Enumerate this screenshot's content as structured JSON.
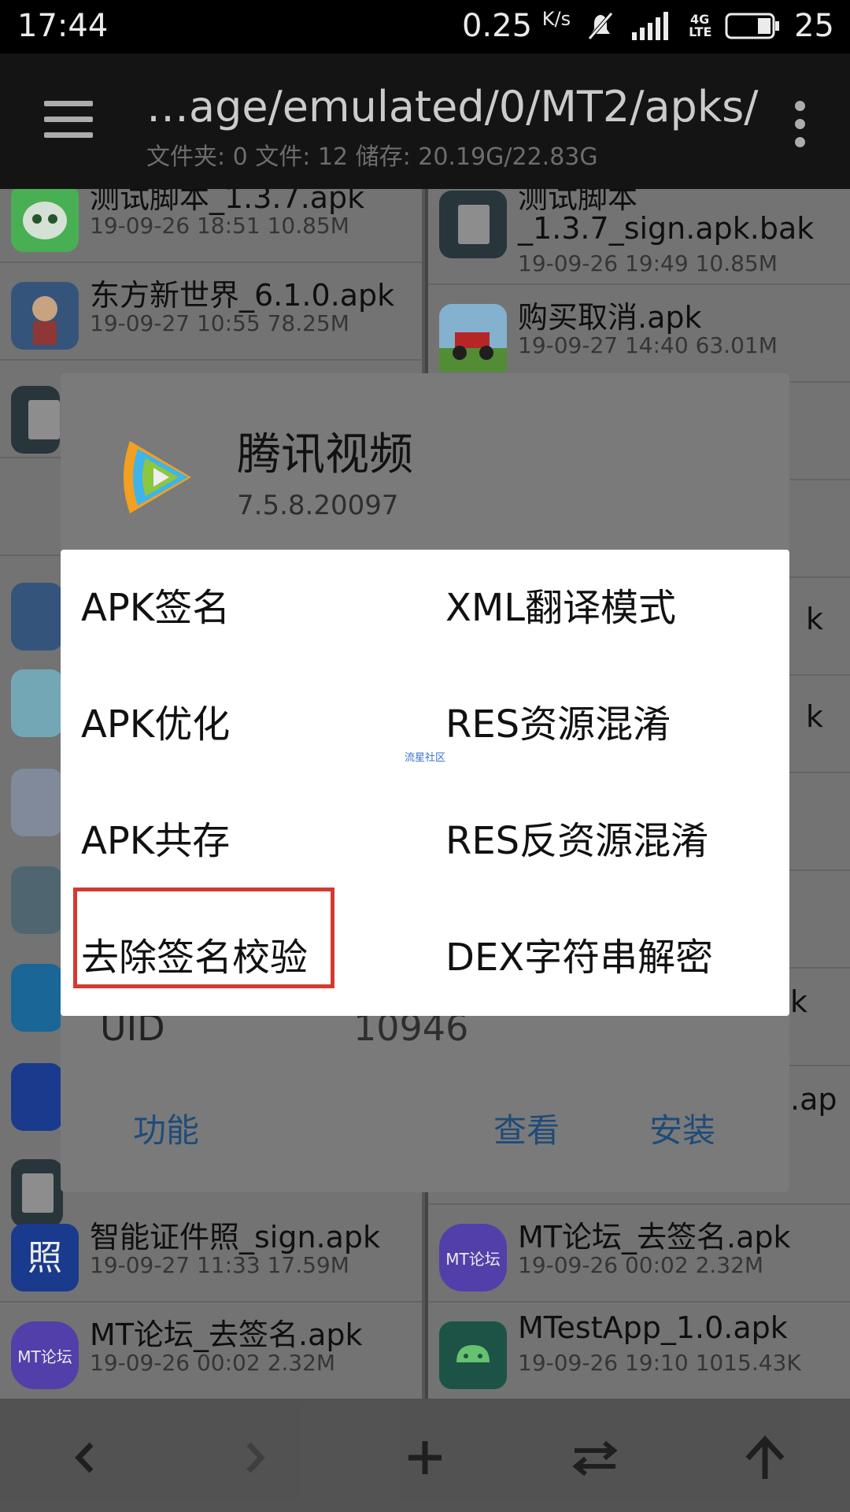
{
  "status": {
    "time": "17:44",
    "net_speed": "0.25",
    "net_unit": "K/s",
    "network_tag": "4G LTE",
    "battery": "25"
  },
  "appbar": {
    "path": "…age/emulated/0/MT2/apks/",
    "info": "文件夹: 0  文件: 12  储存: 20.19G/22.83G"
  },
  "left_files": [
    {
      "name": "测试脚本_1.3.7.apk",
      "meta": "19-09-26 18:51  10.85M",
      "icon": "android-robot-icon"
    },
    {
      "name": "东方新世界_6.1.0.apk",
      "meta": "19-09-27 10:55  78.25M",
      "icon": "game-character-icon"
    },
    {
      "name": "",
      "meta": "",
      "icon": "file-icon"
    },
    {
      "name": "",
      "meta": "",
      "icon": "game-character-icon"
    },
    {
      "name": "",
      "meta": "",
      "icon": "anime-character-icon"
    },
    {
      "name": "",
      "meta": "",
      "icon": "hexagon-app-icon"
    },
    {
      "name": "",
      "meta": "",
      "icon": "tencent-video-icon"
    },
    {
      "name": "",
      "meta": "",
      "icon": "t-app-icon"
    },
    {
      "name": "",
      "meta": "",
      "icon": "zhao-icon"
    },
    {
      "name": "",
      "meta": "",
      "icon": "file-icon"
    },
    {
      "name": "智能证件照_sign.apk",
      "meta": "19-09-27 11:33  17.59M",
      "icon": "zhao-icon"
    },
    {
      "name": "MT论坛_去签名.apk",
      "meta": "19-09-26 00:02  2.32M",
      "icon": "mt-forum-icon"
    }
  ],
  "right_files": [
    {
      "name": "测试脚本",
      "name2": "_1.3.7_sign.apk.bak",
      "meta": "19-09-26 19:49  10.85M",
      "icon": "file-icon"
    },
    {
      "name": "购买取消.apk",
      "meta": "19-09-27 14:40  63.01M",
      "icon": "car-game-icon"
    },
    {
      "name": "",
      "meta": ""
    },
    {
      "name": "",
      "meta": ""
    },
    {
      "name": "k",
      "meta": ""
    },
    {
      "name": "k",
      "meta": ""
    },
    {
      "name": "",
      "meta": ""
    },
    {
      "name": "",
      "meta": ""
    },
    {
      "name": "k",
      "meta": ""
    },
    {
      "name": ".ap",
      "meta": ""
    },
    {
      "name": "MT论坛_去签名.apk",
      "meta": "19-09-26 00:02  2.32M",
      "icon": "mt-forum-icon"
    },
    {
      "name": "MTestApp_1.0.apk",
      "meta": "19-09-26 19:10  1015.43K",
      "icon": "android-app-icon"
    }
  ],
  "info_dialog": {
    "app_name": "腾讯视频",
    "version": "7.5.8.20097",
    "uid_label": "UID",
    "uid_value": "10946",
    "btn_function": "功能",
    "btn_view": "查看",
    "btn_install": "安装"
  },
  "menu": {
    "items": [
      {
        "left": "APK签名",
        "right": "XML翻译模式"
      },
      {
        "left": "APK优化",
        "right": "RES资源混淆"
      },
      {
        "left": "APK共存",
        "right": "RES反资源混淆"
      },
      {
        "left": "去除签名校验",
        "right": "DEX字符串解密"
      }
    ],
    "watermark": "流星社区",
    "highlight_color": "#d23a32"
  },
  "bottom_nav": {
    "back": "‹",
    "forward": "›",
    "add": "+",
    "swap": "⇄",
    "up": "↑"
  }
}
